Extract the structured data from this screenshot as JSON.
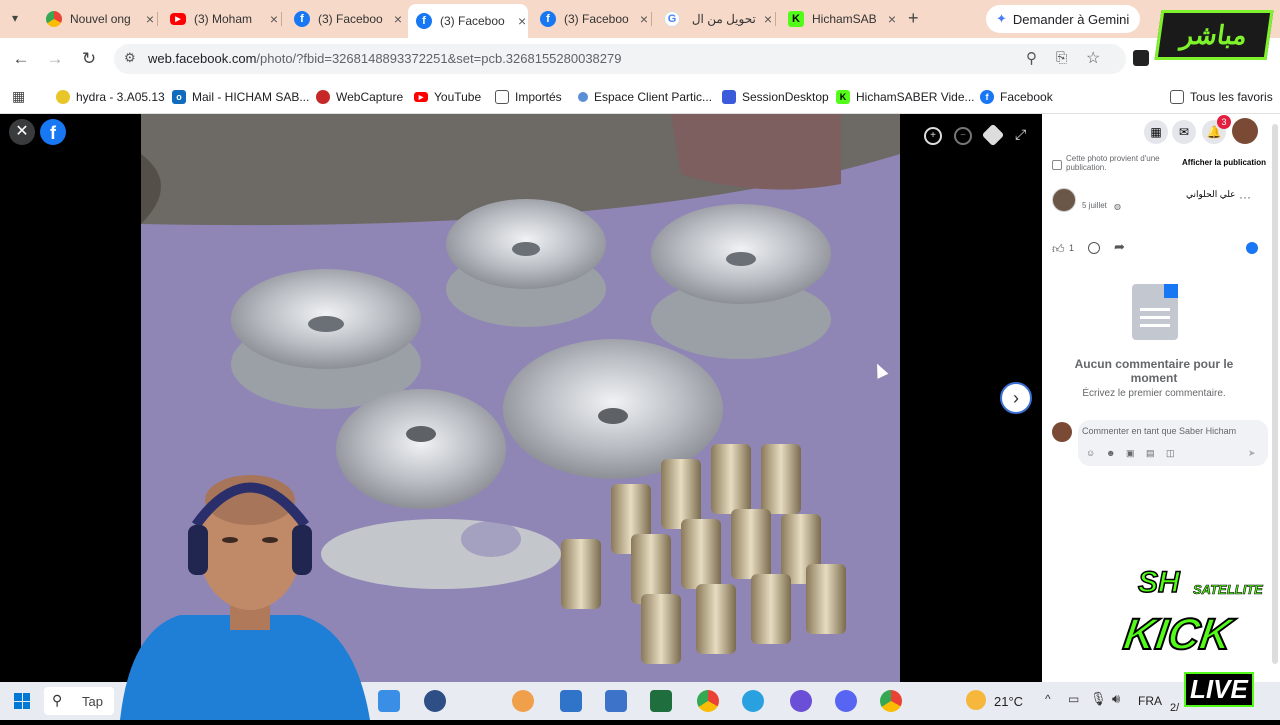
{
  "tabs": [
    {
      "title": "Nouvel ong",
      "icon": "chrome-icon"
    },
    {
      "title": "(3) Moham",
      "icon": "youtube-icon"
    },
    {
      "title": "(3) Faceboo",
      "icon": "facebook-icon"
    },
    {
      "title": "(3) Faceboo",
      "icon": "facebook-icon",
      "active": true
    },
    {
      "title": "(3) Faceboo",
      "icon": "facebook-icon"
    },
    {
      "title": "تحويل من ال",
      "icon": "google-icon"
    },
    {
      "title": "HichamSAB",
      "icon": "kick-icon"
    }
  ],
  "gemini_label": "Demander à Gemini",
  "url": {
    "host": "web.facebook.com",
    "path": "/photo/?fbid=3268148893372251&set=pcb.3268155280038279"
  },
  "bookmarks": [
    {
      "label": "hydra - 3.A05.13"
    },
    {
      "label": "Mail - HICHAM SAB..."
    },
    {
      "label": "WebCapture"
    },
    {
      "label": "YouTube"
    },
    {
      "label": "Importés"
    },
    {
      "label": "Espace Client Partic..."
    },
    {
      "label": "SessionDesktop"
    },
    {
      "label": "HichamSABER Vide..."
    },
    {
      "label": "Facebook"
    }
  ],
  "all_bookmarks_label": "Tous les favoris",
  "notifications_count": "3",
  "side": {
    "photo_origin": "Cette photo provient d'une publication.",
    "view_post": "Afficher la publication",
    "author": "علي الحلواني",
    "date": "5 juillet",
    "likes": "1",
    "no_comments_title": "Aucun commentaire pour le moment",
    "no_comments_sub": "Écrivez le premier commentaire.",
    "comment_placeholder": "Commenter en tant que Saber Hicham"
  },
  "taskbar": {
    "search": "Tap",
    "weather": "21°C",
    "lang": "FRA",
    "clock_partial": "2/"
  },
  "overlay": {
    "mubashir": "مباشر",
    "kick_top": "SH",
    "kick_sat": "SATELLITE",
    "kick_main": "KICK",
    "kick_live": "LIVE"
  },
  "colors": {
    "facebook_blue": "#1877f2",
    "kick_green": "#53fc18",
    "tabstrip_bg": "#f6d9c8"
  }
}
